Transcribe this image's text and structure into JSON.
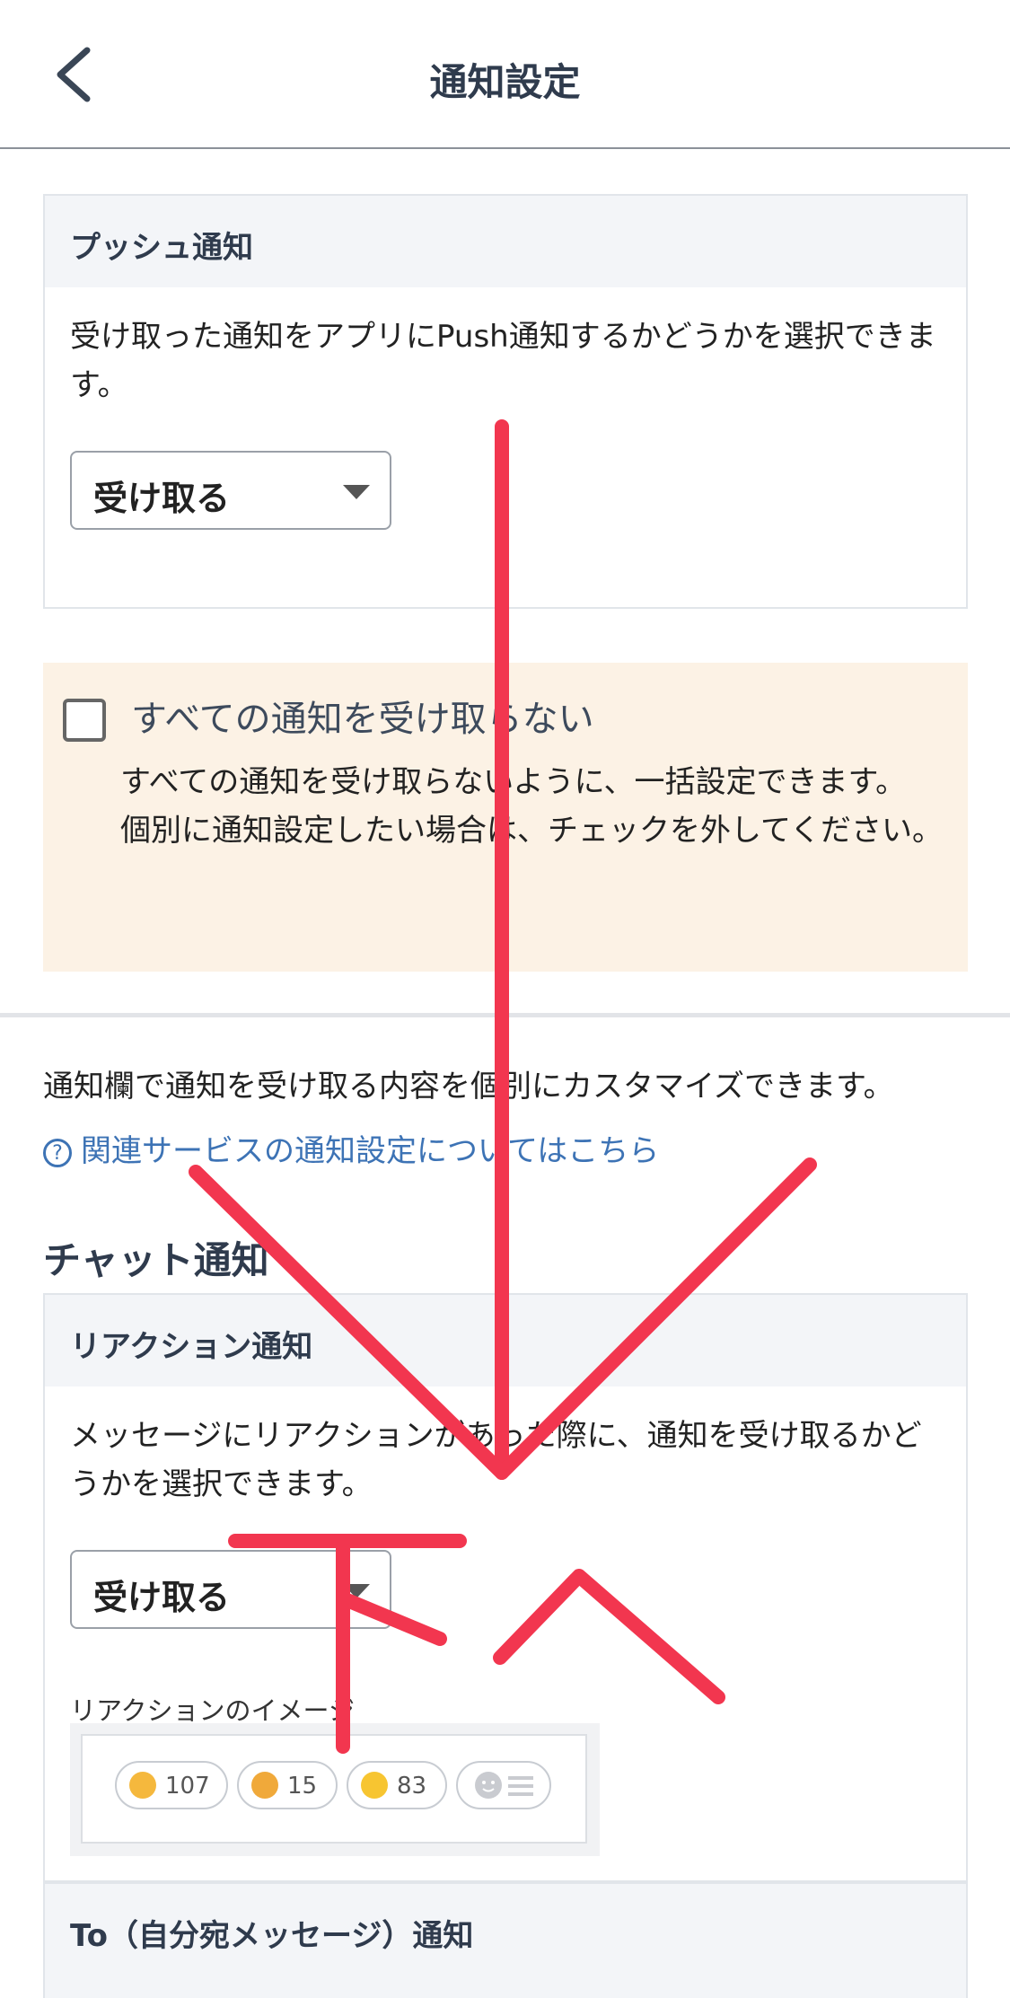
{
  "header": {
    "title": "通知設定"
  },
  "push": {
    "heading": "プッシュ通知",
    "description": "受け取った通知をアプリにPush通知するかどうかを選択できます。",
    "select_value": "受け取る"
  },
  "mute_all": {
    "label": "すべての通知を受け取らない",
    "text_1": "すべての通知を受け取らないように、一括設定できます。",
    "text_2": "個別に通知設定したい場合は、チェックを外してください。"
  },
  "intro": "通知欄で通知を受け取る内容を個別にカスタマイズできます。",
  "help_link": "関連サービスの通知設定についてはこちら",
  "chat_section": {
    "title": "チャット通知"
  },
  "reaction": {
    "heading": "リアクション通知",
    "description": "メッセージにリアクションがあった際に、通知を受け取るかどうかを選択できます。",
    "select_value": "受け取る",
    "image_label": "リアクションのイメージ",
    "pills": [
      {
        "icon": "thumbs-up-icon",
        "count": "107",
        "color": "#f5b83d"
      },
      {
        "icon": "praying-hands-icon",
        "count": "15",
        "color": "#f0a93a"
      },
      {
        "icon": "laughing-face-icon",
        "count": "83",
        "color": "#f7c531"
      }
    ]
  },
  "to_section": {
    "heading": "To（自分宛メッセージ）通知"
  },
  "annotation": {
    "text": "下へ",
    "color": "#f2364f"
  }
}
